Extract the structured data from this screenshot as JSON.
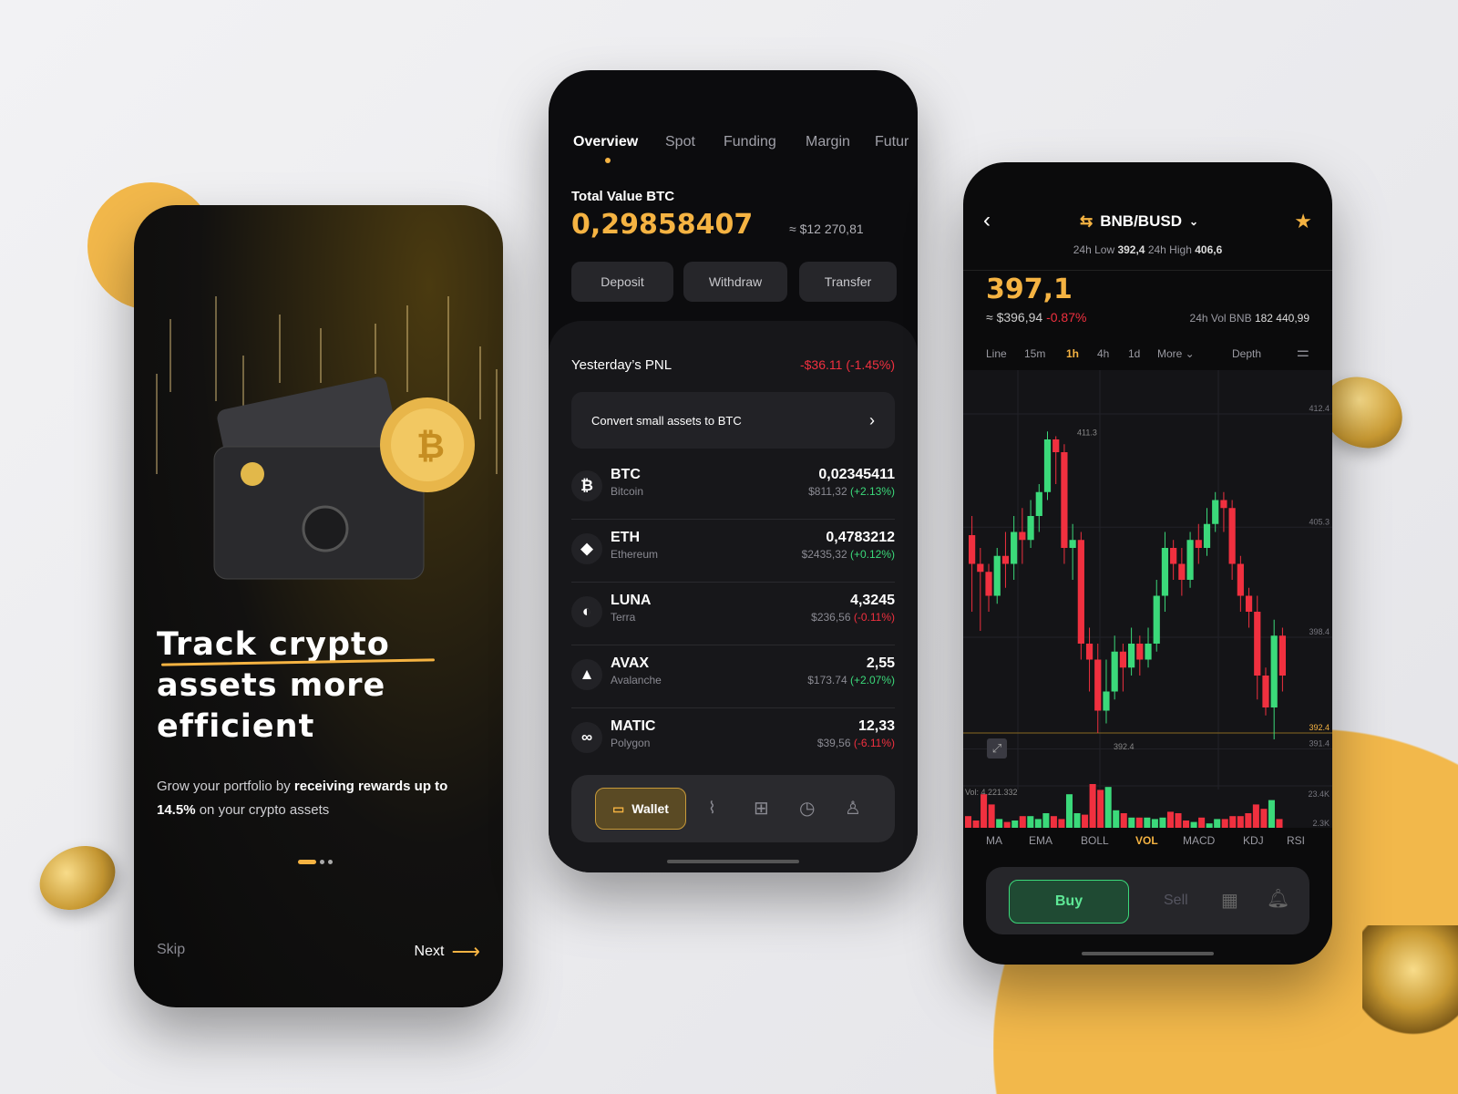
{
  "onboarding": {
    "title_lines": [
      "Track crypto",
      "assets more",
      "efficient"
    ],
    "subtitle_pre": "Grow your portfolio by ",
    "subtitle_bold1": "receiving rewards",
    "subtitle_bold2": "up to 14.5%",
    "subtitle_post": " on your crypto assets",
    "skip": "Skip",
    "next": "Next",
    "page_index": 1,
    "page_count": 3
  },
  "wallet": {
    "tabs": [
      "Overview",
      "Spot",
      "Funding",
      "Margin",
      "Futur"
    ],
    "active_tab": 0,
    "total_label": "Total Value BTC",
    "total_value": "0,29858407",
    "total_usd": "≈ $12 270,81",
    "actions": [
      "Deposit",
      "Withdraw",
      "Transfer"
    ],
    "pnl_label": "Yesterday’s PNL",
    "pnl_value": "-$36.11 (-1.45%)",
    "convert_label": "Convert small assets to BTC",
    "assets": [
      {
        "symbol": "BTC",
        "name": "Bitcoin",
        "amount": "0,02345411",
        "usd": "$811,32",
        "change": "(+2.13%)",
        "trend": "up",
        "icon": "₿"
      },
      {
        "symbol": "ETH",
        "name": "Ethereum",
        "amount": "0,4783212",
        "usd": "$2435,32",
        "change": "(+0.12%)",
        "trend": "up",
        "icon": "◆"
      },
      {
        "symbol": "LUNA",
        "name": "Terra",
        "amount": "4,3245",
        "usd": "$236,56",
        "change": "(-0.11%)",
        "trend": "down",
        "icon": "◐"
      },
      {
        "symbol": "AVAX",
        "name": "Avalanche",
        "amount": "2,55",
        "usd": "$173.74",
        "change": "(+2.07%)",
        "trend": "up",
        "icon": "▲"
      },
      {
        "symbol": "MATIC",
        "name": "Polygon",
        "amount": "12,33",
        "usd": "$39,56",
        "change": "(-6.11%)",
        "trend": "down",
        "icon": "∞"
      }
    ],
    "nav_wallet": "Wallet"
  },
  "trade": {
    "pair": "BNB/BUSD",
    "low_label": "24h Low",
    "low": "392,4",
    "high_label": "24h High",
    "high": "406,6",
    "price": "397,1",
    "price_usd": "≈ $396,94",
    "change": "-0.87%",
    "vol_label": "24h Vol BNB",
    "vol": "182 440,99",
    "timeframes": [
      "Line",
      "15m",
      "1h",
      "4h",
      "1d",
      "More",
      "Depth"
    ],
    "active_timeframe": "1h",
    "indicators": [
      "MA",
      "EMA",
      "BOLL",
      "VOL",
      "MACD",
      "KDJ",
      "RSI"
    ],
    "active_indicator": "VOL",
    "buy": "Buy",
    "sell": "Sell"
  },
  "chart_data": {
    "type": "candlestick",
    "price_axis_labels": [
      "412.4",
      "405.3",
      "398.4",
      "392.4",
      "391.4"
    ],
    "volume_axis_labels": [
      "23.4K",
      "2.3K"
    ],
    "annotations": {
      "high": "411.3",
      "low": "392.4",
      "volume": "Vol: 4,221.332"
    },
    "current_price": 392.4,
    "ylim": [
      390,
      414
    ],
    "candles": [
      [
        404.8,
        403,
        406,
        400
      ],
      [
        403,
        402.5,
        404,
        398.8
      ],
      [
        402.5,
        401,
        403,
        400
      ],
      [
        401,
        403.5,
        404,
        400.5
      ],
      [
        403.5,
        403,
        405,
        401.5
      ],
      [
        403,
        405,
        406,
        402
      ],
      [
        405,
        404.5,
        406.5,
        403
      ],
      [
        404.5,
        406,
        407,
        404
      ],
      [
        406,
        407.5,
        408,
        405
      ],
      [
        407.5,
        410.8,
        411.3,
        407
      ],
      [
        410.8,
        410,
        411,
        408
      ],
      [
        410,
        404,
        410.5,
        403
      ],
      [
        404,
        404.5,
        405.5,
        402
      ],
      [
        404.5,
        398,
        405,
        397
      ],
      [
        398,
        397,
        399,
        395
      ],
      [
        397,
        393.8,
        398,
        392.4
      ],
      [
        393.8,
        395,
        397,
        393
      ],
      [
        395,
        397.5,
        398.5,
        394.5
      ],
      [
        397.5,
        396.5,
        398,
        395
      ],
      [
        396.5,
        398,
        399,
        396
      ],
      [
        398,
        397,
        398.5,
        396
      ],
      [
        397,
        398,
        399,
        396.5
      ],
      [
        398,
        401,
        402,
        397.5
      ],
      [
        401,
        404,
        405,
        400
      ],
      [
        404,
        403,
        404.5,
        402
      ],
      [
        403,
        402,
        404,
        401
      ],
      [
        402,
        404.5,
        405,
        401.5
      ],
      [
        404.5,
        404,
        405.5,
        403
      ],
      [
        404,
        405.5,
        406.5,
        403.5
      ],
      [
        405.5,
        407,
        407.5,
        405
      ],
      [
        407,
        406.5,
        407.5,
        405
      ],
      [
        406.5,
        403,
        407,
        402
      ],
      [
        403,
        401,
        403.5,
        400
      ],
      [
        401,
        400,
        401.5,
        399
      ],
      [
        400,
        396,
        401,
        394.5
      ],
      [
        396,
        394,
        396.5,
        393.5
      ],
      [
        394,
        398.5,
        399.5,
        392
      ],
      [
        398.5,
        396,
        399,
        395
      ]
    ],
    "volumes": [
      8,
      5,
      23,
      16,
      6,
      4,
      5,
      8,
      8,
      6,
      10,
      8,
      6,
      23,
      10,
      9,
      30,
      26,
      28,
      12,
      10,
      7,
      7,
      7,
      6,
      7,
      11,
      10,
      5,
      4,
      7,
      3,
      6,
      6,
      8,
      8,
      10,
      16,
      13,
      19,
      6
    ]
  },
  "colors": {
    "accent": "#f5b342",
    "up": "#3bd97a",
    "down": "#f0303f"
  }
}
